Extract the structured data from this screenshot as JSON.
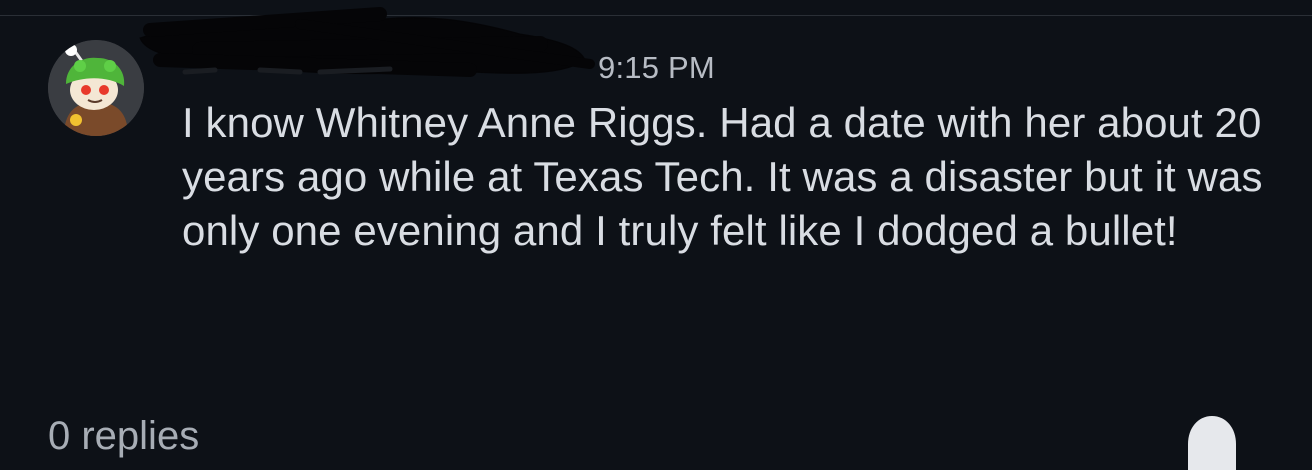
{
  "comment": {
    "time": "9:15 PM",
    "body": "I know Whitney Anne Riggs. Had a date with her about 20 years ago while at Texas Tech. It was a disaster but it was only one evening and I truly felt like I dodged a bullet!"
  },
  "footer": {
    "replies_label": "0 replies",
    "action_icon": "ghost-icon"
  },
  "avatar": {
    "icon": "snoo-avatar-icon",
    "hat_color": "#4fb53a",
    "background_color": "#3a3d42"
  },
  "colors": {
    "background": "#0d1117",
    "text": "#d9dde3",
    "muted_text": "#b7bcc4"
  }
}
